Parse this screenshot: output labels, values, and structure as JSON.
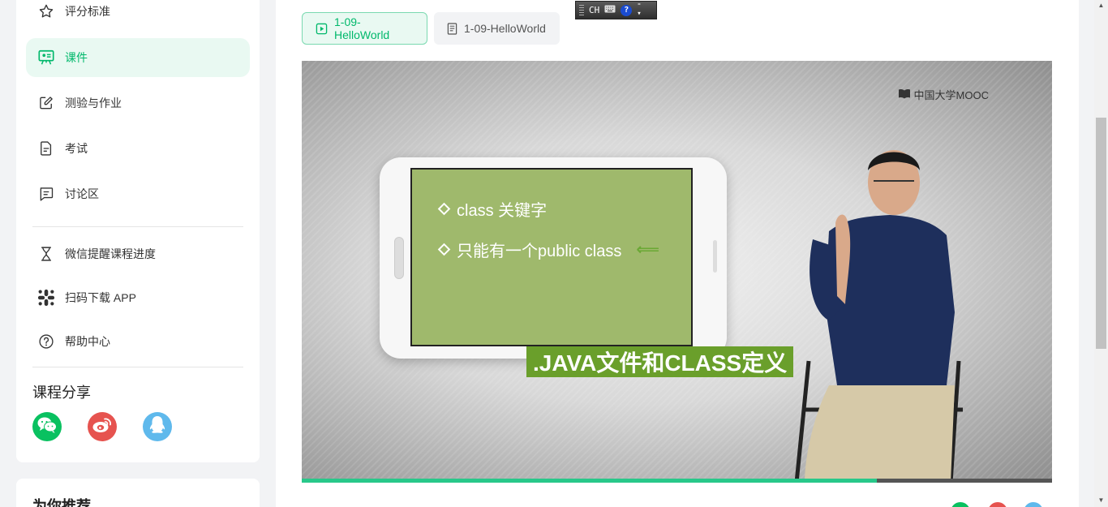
{
  "sidebar": {
    "items": [
      {
        "label": "评分标准",
        "icon": "star-icon"
      },
      {
        "label": "课件",
        "icon": "courseware-icon",
        "active": true
      },
      {
        "label": "测验与作业",
        "icon": "edit-icon"
      },
      {
        "label": "考试",
        "icon": "document-icon"
      },
      {
        "label": "讨论区",
        "icon": "chat-icon"
      },
      {
        "label": "微信提醒课程进度",
        "icon": "hourglass-icon"
      },
      {
        "label": "扫码下载 APP",
        "icon": "qr-icon"
      },
      {
        "label": "帮助中心",
        "icon": "help-icon"
      }
    ],
    "share_title": "课程分享",
    "share": [
      "wechat-icon",
      "weibo-icon",
      "qq-icon"
    ],
    "recommend_title": "为你推荐"
  },
  "tabs": [
    {
      "label": "1-09-HelloWorld",
      "icon": "play-icon",
      "active": true
    },
    {
      "label": "1-09-HelloWorld",
      "icon": "doc-icon",
      "active": false
    }
  ],
  "ime": {
    "label": "CH"
  },
  "video": {
    "logo": "中国大学MOOC",
    "bullets": [
      "class 关键字",
      "只能有一个public class"
    ],
    "caption": ".JAVA文件和CLASS定义",
    "progress": 0.766
  },
  "colors": {
    "accent": "#00b86b",
    "active_bg": "#e9f9f2",
    "slide": "#9fb96c",
    "caption_bg": "#6a9f2b"
  }
}
